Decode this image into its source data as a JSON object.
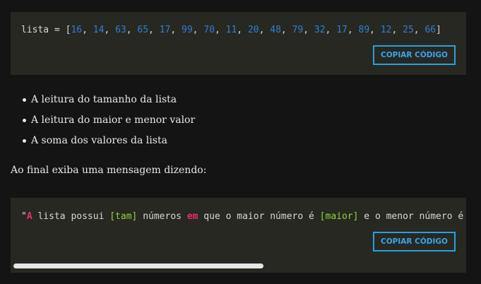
{
  "code_block_1": {
    "prefix": "lista = [",
    "numbers": [
      "16",
      "14",
      "63",
      "65",
      "17",
      "99",
      "70",
      "11",
      "20",
      "48",
      "79",
      "32",
      "17",
      "89",
      "12",
      "25",
      "66"
    ],
    "suffix": "]",
    "copy_label": "COPIAR CÓDIGO"
  },
  "list_items": [
    "A leitura do tamanho da lista",
    "A leitura do maior e menor valor",
    "A soma dos valores da lista"
  ],
  "paragraph": "Ao final exiba uma mensagem dizendo:",
  "code_block_2": {
    "seg_quote": "\"",
    "seg_a": "A",
    "seg_1": " lista possui ",
    "seg_tam": "[tam]",
    "seg_2": " números ",
    "seg_em": "em",
    "seg_3": " que o maior número é ",
    "seg_maior": "[maior]",
    "seg_4": " e o menor número é",
    "copy_label": "COPIAR CÓDIGO"
  },
  "colors": {
    "background": "#141414",
    "code_background": "#272822",
    "number": "#2f7fd6",
    "keyword": "#f02a70",
    "placeholder": "#8fd43c",
    "button": "#2b9fe0"
  }
}
